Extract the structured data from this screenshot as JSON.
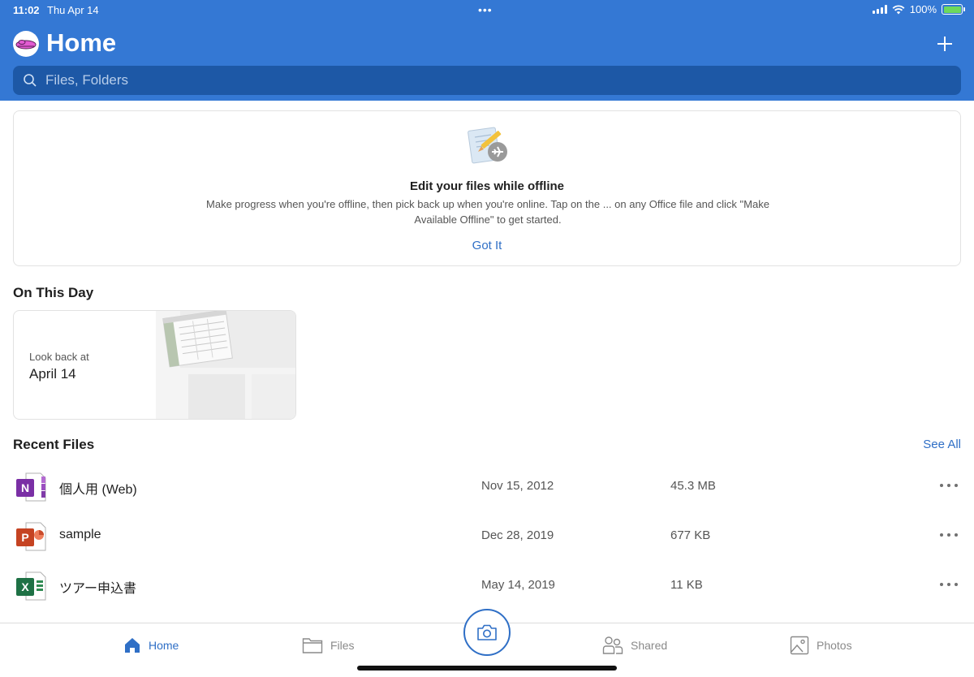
{
  "status_bar": {
    "time": "11:02",
    "date": "Thu Apr 14",
    "battery": "100%"
  },
  "header": {
    "title": "Home"
  },
  "search": {
    "placeholder": "Files, Folders"
  },
  "offline_card": {
    "title": "Edit your files while offline",
    "body": "Make progress when you're offline, then pick back up when you're online. Tap on the ... on any Office file and click \"Make Available Offline\" to get started.",
    "action": "Got It"
  },
  "on_this_day": {
    "title": "On This Day",
    "kicker": "Look back at",
    "date": "April 14"
  },
  "recent": {
    "title": "Recent Files",
    "see_all": "See All",
    "files": [
      {
        "name": "個人用 (Web)",
        "date": "Nov 15, 2012",
        "size": "45.3 MB",
        "type": "onenote"
      },
      {
        "name": "sample",
        "date": "Dec 28, 2019",
        "size": "677 KB",
        "type": "powerpoint"
      },
      {
        "name": "ツアー申込書",
        "date": "May 14, 2019",
        "size": "11 KB",
        "type": "excel"
      }
    ]
  },
  "tabs": [
    {
      "label": "Home",
      "active": true
    },
    {
      "label": "Files",
      "active": false
    },
    {
      "label": "Shared",
      "active": false
    },
    {
      "label": "Photos",
      "active": false
    }
  ],
  "colors": {
    "brand": "#3478d4",
    "accent": "#2f6fc6",
    "search_bg": "#1d58a6"
  }
}
